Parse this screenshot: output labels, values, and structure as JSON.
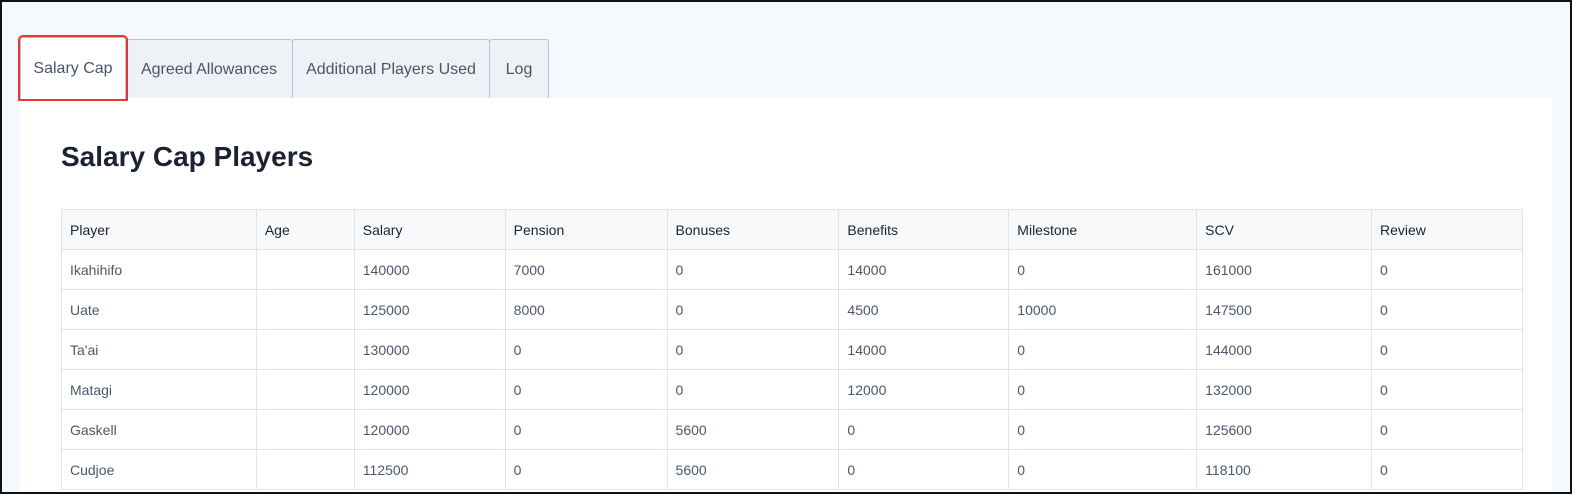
{
  "tabs": [
    {
      "label": "Salary Cap"
    },
    {
      "label": "Agreed Allowances"
    },
    {
      "label": "Additional Players Used"
    },
    {
      "label": "Log"
    }
  ],
  "page": {
    "title": "Salary Cap Players"
  },
  "table": {
    "headers": [
      "Player",
      "Age",
      "Salary",
      "Pension",
      "Bonuses",
      "Benefits",
      "Milestone",
      "SCV",
      "Review"
    ],
    "rows": [
      [
        "Ikahihifo",
        "",
        "140000",
        "7000",
        "0",
        "14000",
        "0",
        "161000",
        "0"
      ],
      [
        "Uate",
        "",
        "125000",
        "8000",
        "0",
        "4500",
        "10000",
        "147500",
        "0"
      ],
      [
        "Ta'ai",
        "",
        "130000",
        "0",
        "0",
        "14000",
        "0",
        "144000",
        "0"
      ],
      [
        "Matagi",
        "",
        "120000",
        "0",
        "0",
        "12000",
        "0",
        "132000",
        "0"
      ],
      [
        "Gaskell",
        "",
        "120000",
        "0",
        "5600",
        "0",
        "0",
        "125600",
        "0"
      ],
      [
        "Cudjoe",
        "",
        "112500",
        "0",
        "5600",
        "0",
        "0",
        "118100",
        "0"
      ]
    ]
  }
}
